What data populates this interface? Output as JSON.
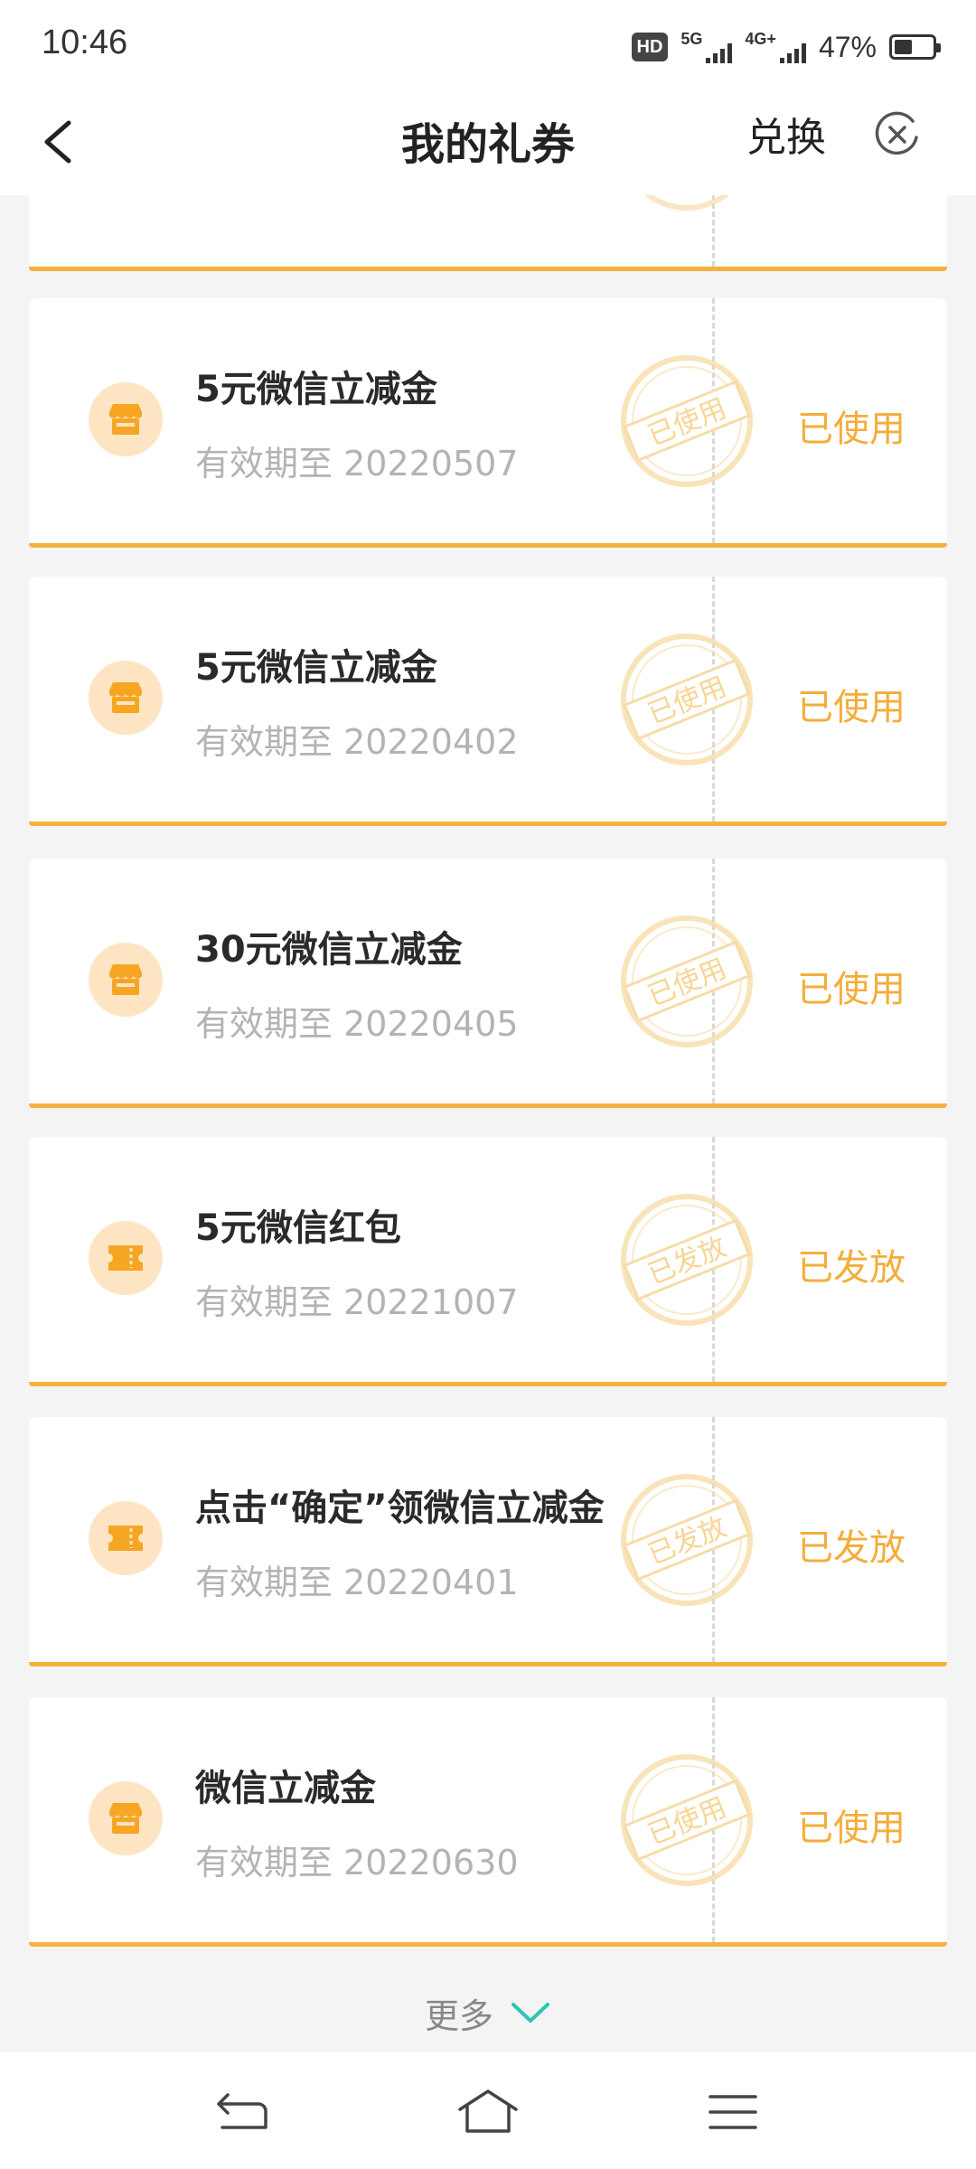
{
  "status_bar": {
    "time": "10:46",
    "hd_badge": "HD",
    "network_1": "5G",
    "network_2": "4G+",
    "battery_percent": "47%",
    "battery_level": 0.47
  },
  "header": {
    "title": "我的礼券",
    "redeem_label": "兑换"
  },
  "vouchers": [
    {
      "title": "5元微信立减金",
      "expiry": "有效期至 20220507",
      "status": "已使用",
      "stamp": "已使用",
      "icon": "shop-icon"
    },
    {
      "title": "5元微信立减金",
      "expiry": "有效期至 20220402",
      "status": "已使用",
      "stamp": "已使用",
      "icon": "shop-icon"
    },
    {
      "title": "30元微信立减金",
      "expiry": "有效期至 20220405",
      "status": "已使用",
      "stamp": "已使用",
      "icon": "shop-icon"
    },
    {
      "title": "5元微信红包",
      "expiry": "有效期至 20221007",
      "status": "已发放",
      "stamp": "已发放",
      "icon": "ticket-icon"
    },
    {
      "title": "点击“确定”领微信立减金",
      "expiry": "有效期至 20220401",
      "status": "已发放",
      "stamp": "已发放",
      "icon": "ticket-icon"
    },
    {
      "title": "微信立减金",
      "expiry": "有效期至 20220630",
      "status": "已使用",
      "stamp": "已使用",
      "icon": "shop-icon"
    }
  ],
  "more_label": "更多",
  "colors": {
    "accent": "#f5b240",
    "status_text": "#f4ad3a",
    "icon_bg": "#fde5c4",
    "more_chevron": "#2ec4b6"
  }
}
